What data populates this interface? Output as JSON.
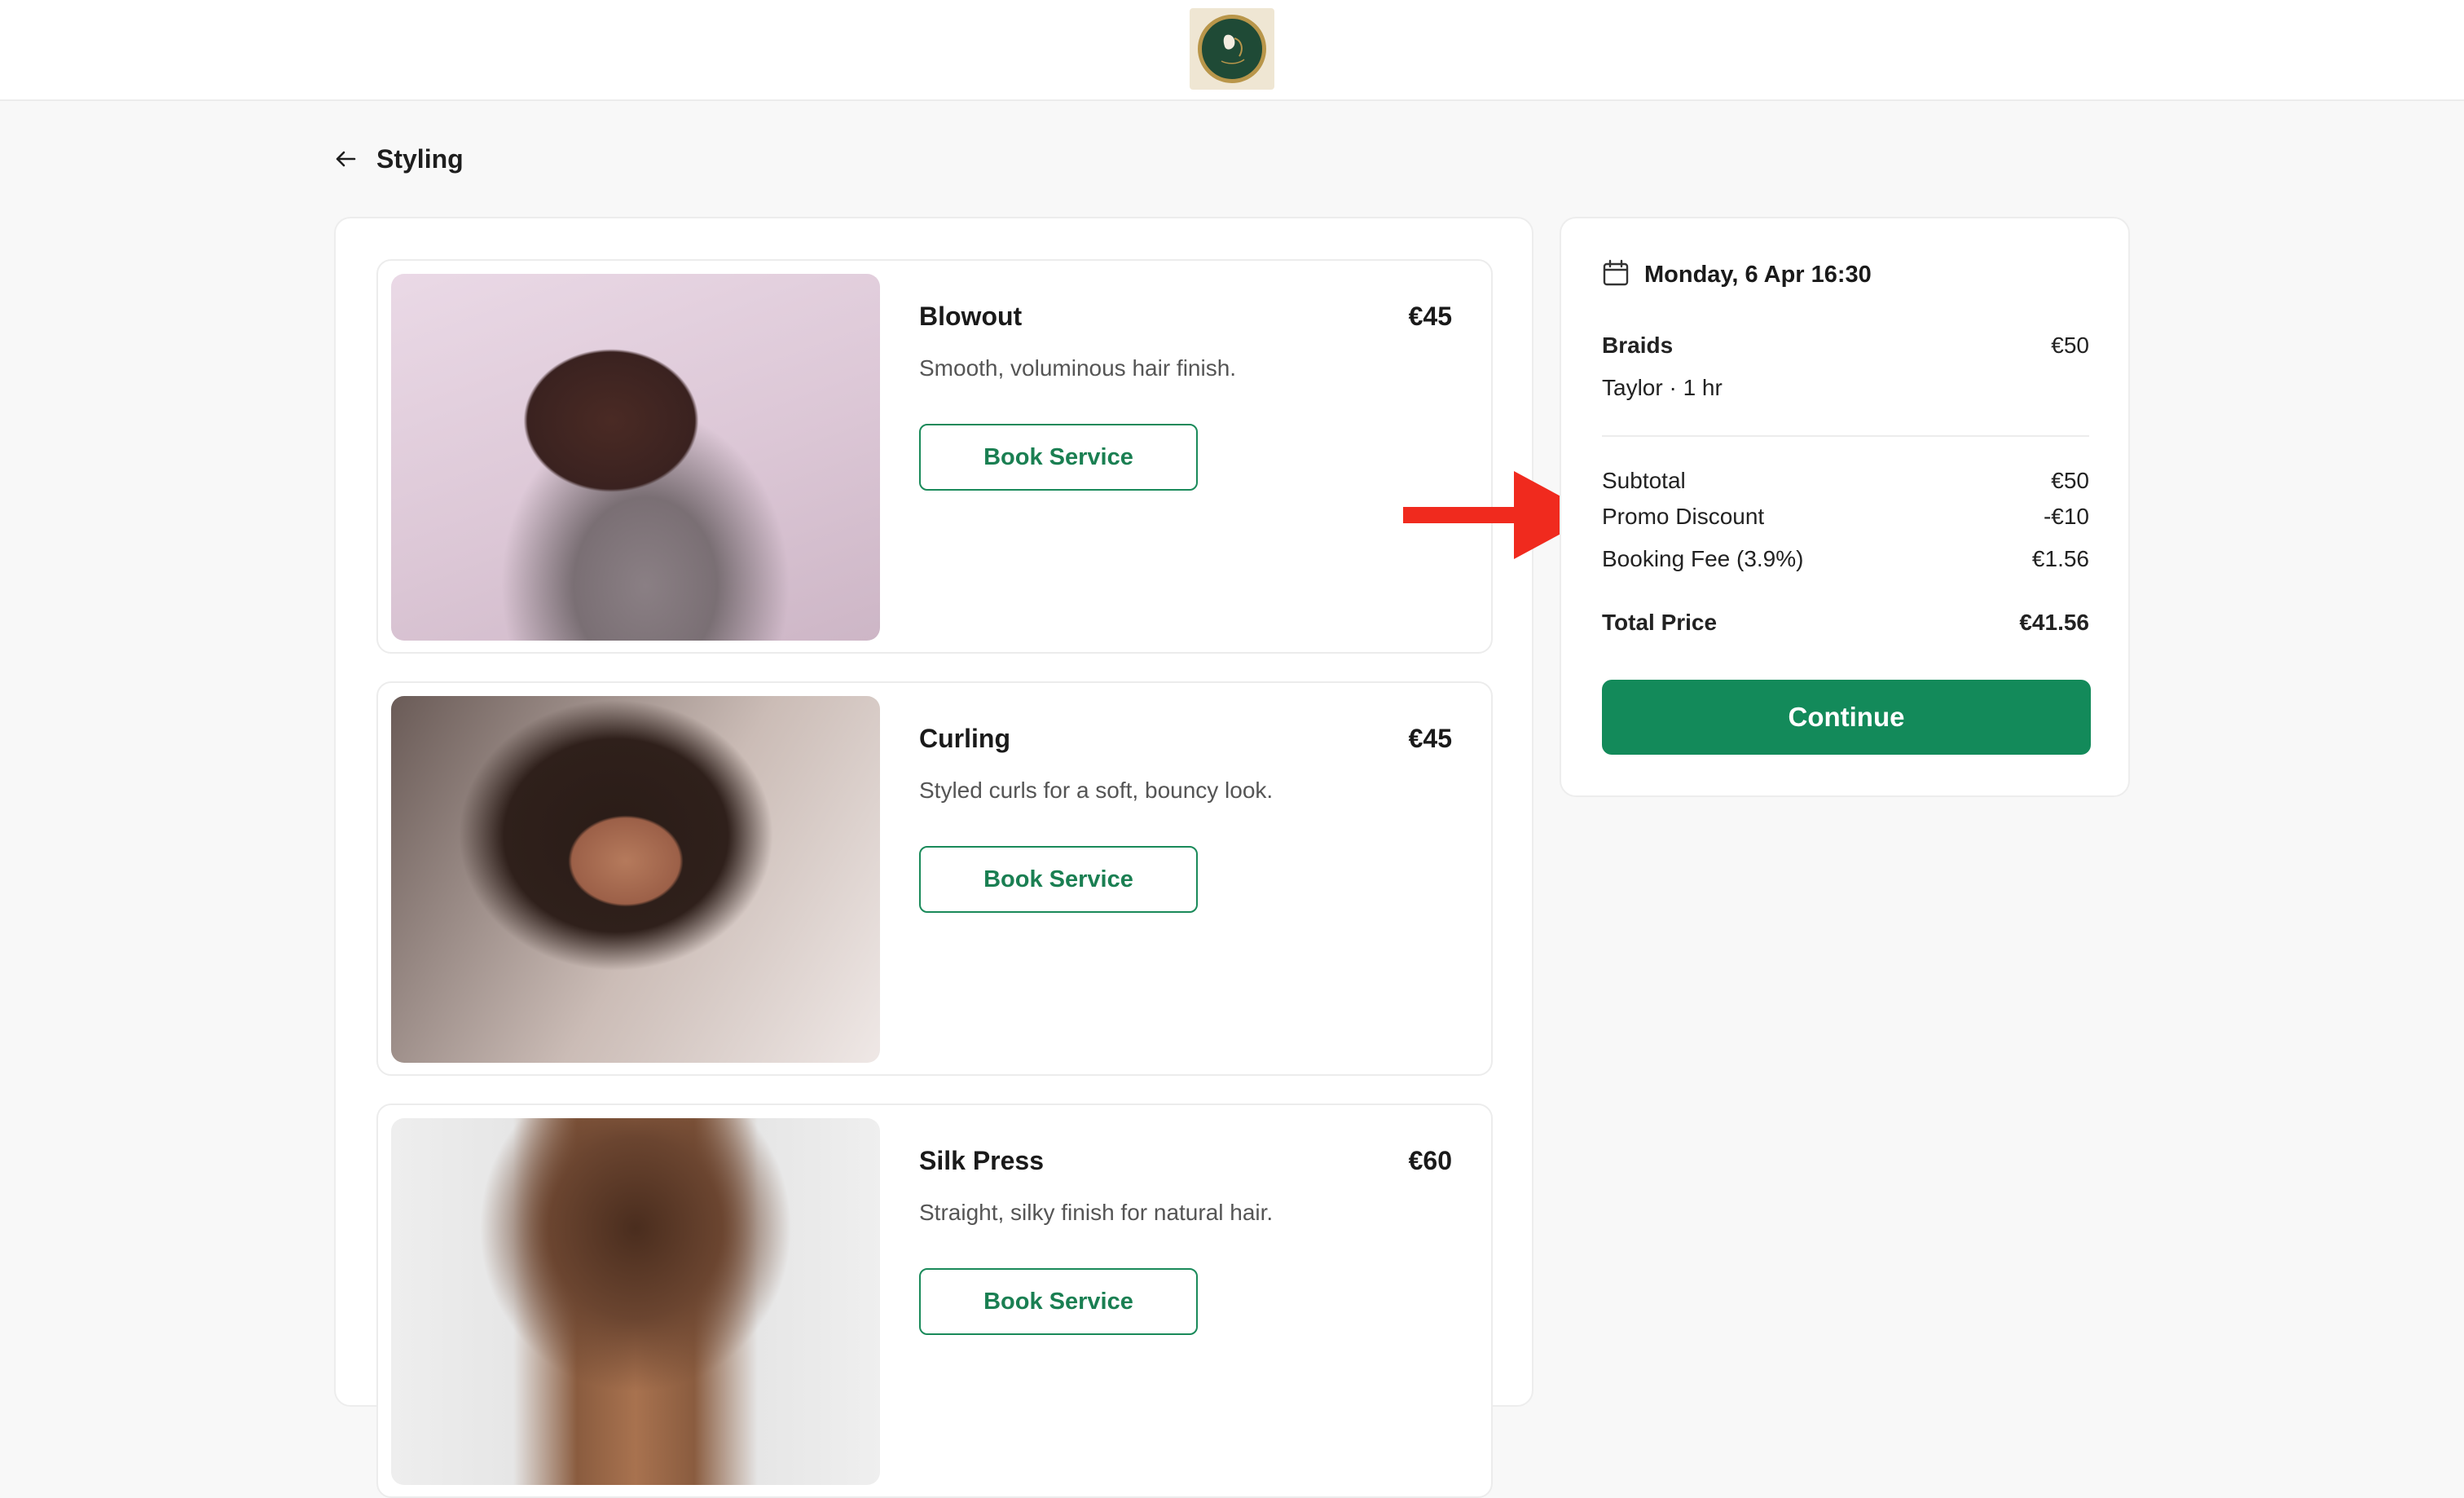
{
  "header": {
    "logo_icon": "salon-logo-icon"
  },
  "page": {
    "back_icon": "arrow-left-icon",
    "title": "Styling"
  },
  "services": [
    {
      "name": "Blowout",
      "price": "€45",
      "description": "Smooth, voluminous hair finish.",
      "button_label": "Book Service"
    },
    {
      "name": "Curling",
      "price": "€45",
      "description": "Styled curls for a soft, bouncy look.",
      "button_label": "Book Service"
    },
    {
      "name": "Silk Press",
      "price": "€60",
      "description": "Straight, silky finish for natural hair.",
      "button_label": "Book Service"
    }
  ],
  "summary": {
    "calendar_icon": "calendar-icon",
    "date": "Monday, 6 Apr 16:30",
    "service_name": "Braids",
    "service_price": "€50",
    "stylist_duration": "Taylor · 1 hr",
    "subtotal_label": "Subtotal",
    "subtotal_value": "€50",
    "promo_label": "Promo Discount",
    "promo_value": "-€10",
    "fee_label": "Booking Fee (3.9%)",
    "fee_value": "€1.56",
    "total_label": "Total Price",
    "total_value": "€41.56",
    "continue_label": "Continue"
  },
  "annotation": {
    "arrow_icon": "red-arrow-icon",
    "color": "#f02a1e"
  },
  "colors": {
    "accent": "#138a5a",
    "background": "#f8f8f8"
  }
}
